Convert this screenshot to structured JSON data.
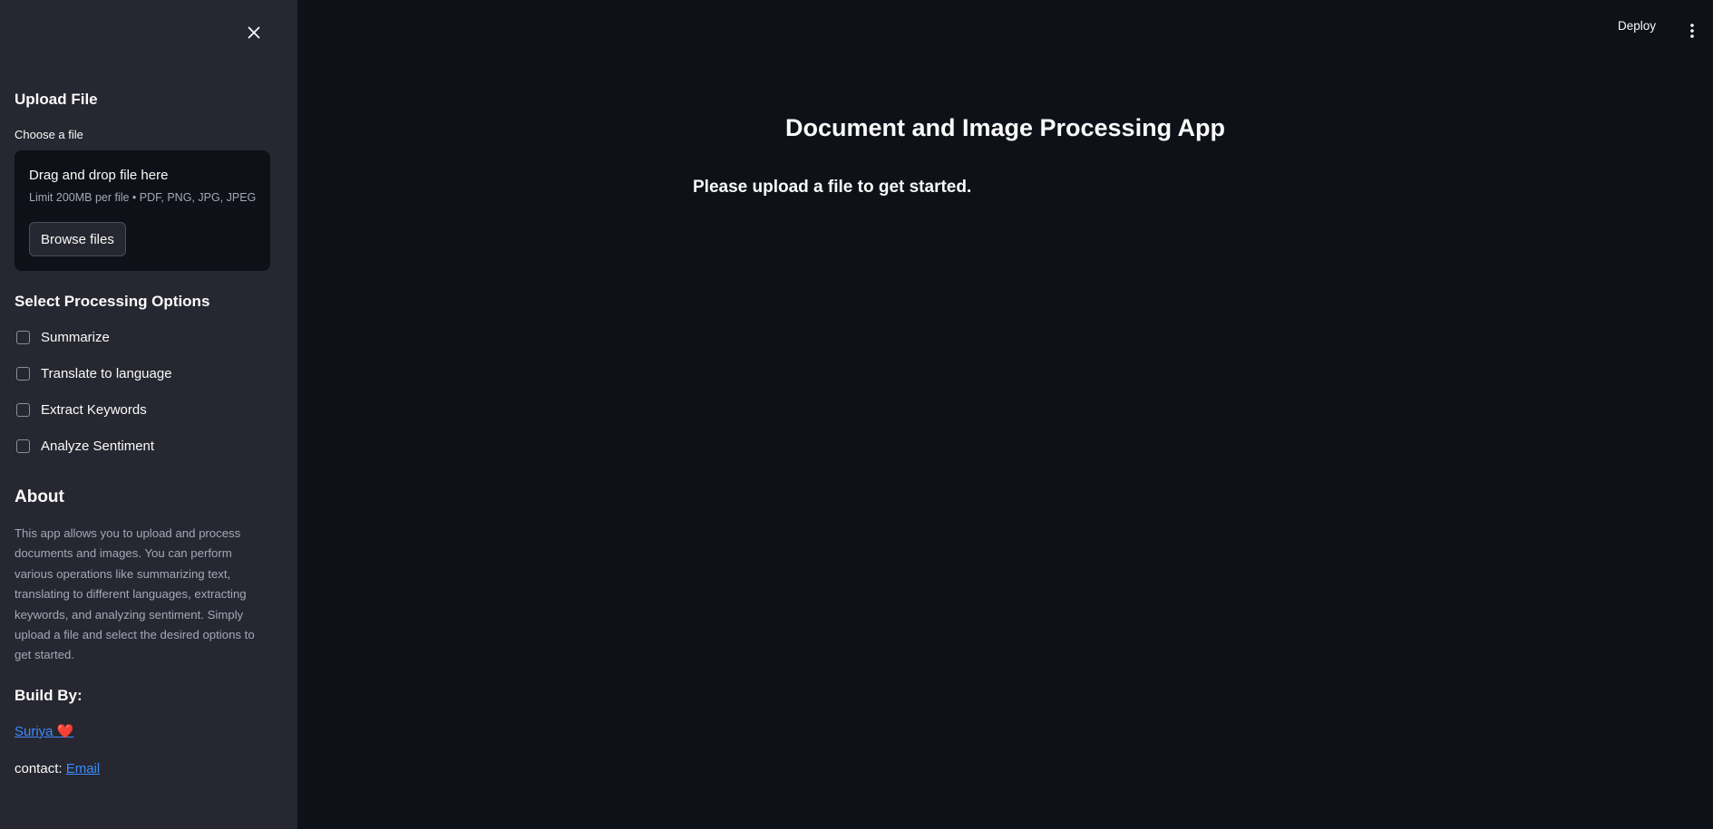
{
  "sidebar": {
    "upload_section_title": "Upload File",
    "choose_file_label": "Choose a file",
    "dropzone": {
      "title": "Drag and drop file here",
      "limit_text": "Limit 200MB per file • PDF, PNG, JPG, JPEG",
      "browse_label": "Browse files"
    },
    "options_title": "Select Processing Options",
    "options": [
      {
        "label": "Summarize",
        "checked": false
      },
      {
        "label": "Translate to language",
        "checked": false
      },
      {
        "label": "Extract Keywords",
        "checked": false
      },
      {
        "label": "Analyze Sentiment",
        "checked": false
      }
    ],
    "about_title": "About",
    "about_text": "This app allows you to upload and process documents and images. You can perform various operations like summarizing text, translating to different languages, extracting keywords, and analyzing sentiment. Simply upload a file and select the desired options to get started.",
    "build_by_title": "Build By:",
    "author_link": "Suriya ❤️",
    "contact_prefix": "contact: ",
    "contact_link": "Email"
  },
  "header": {
    "deploy_label": "Deploy"
  },
  "main": {
    "title": "Document and Image Processing App",
    "message": "Please upload a file to get started."
  },
  "colors": {
    "sidebar_bg": "#262730",
    "main_bg": "#0e1117",
    "link": "#3d8bfd",
    "muted_text": "#a3a8b8"
  },
  "icons": {
    "close": "close-icon",
    "menu": "more-vertical-icon"
  }
}
